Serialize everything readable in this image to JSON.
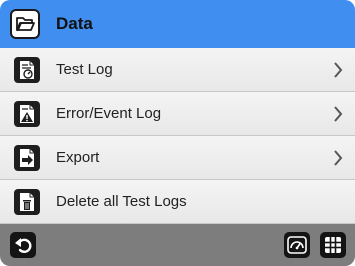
{
  "header": {
    "title": "Data",
    "icon": "folder-open-icon",
    "accent_color": "#3f8ef0"
  },
  "menu": {
    "items": [
      {
        "label": "Test Log",
        "icon": "test-log-icon",
        "has_chevron": true
      },
      {
        "label": "Error/Event Log",
        "icon": "error-log-icon",
        "has_chevron": true
      },
      {
        "label": "Export",
        "icon": "export-icon",
        "has_chevron": true
      },
      {
        "label": "Delete all Test Logs",
        "icon": "delete-icon",
        "has_chevron": false
      }
    ]
  },
  "footer": {
    "back_icon": "back-arrow-icon",
    "gauge_icon": "gauge-icon",
    "menu_icon": "grid-menu-icon",
    "bar_color": "#7d7d7d"
  }
}
